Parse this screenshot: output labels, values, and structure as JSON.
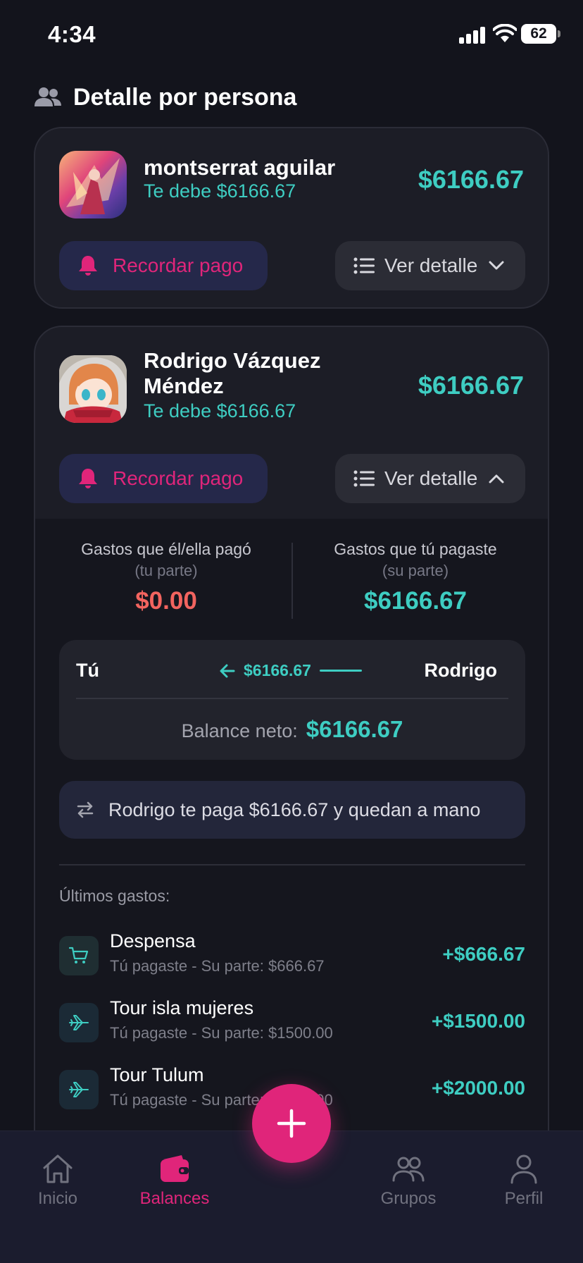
{
  "status_bar": {
    "time": "4:34",
    "battery": "62"
  },
  "section": {
    "title": "Detalle por persona",
    "icon": "people-icon"
  },
  "people": [
    {
      "name": "montserrat aguilar",
      "owes": "Te debe $6166.67",
      "amount": "$6166.67",
      "remind_label": "Recordar pago",
      "detail_label": "Ver detalle"
    },
    {
      "name_line1": "Rodrigo Vázquez",
      "name_line2": "Méndez",
      "owes": "Te debe $6166.67",
      "amount": "$6166.67",
      "remind_label": "Recordar pago",
      "detail_label": "Ver detalle",
      "detail": {
        "paid_by_them_label": "Gastos que él/ella pagó",
        "paid_by_them_sub": "(tu parte)",
        "paid_by_them_value": "$0.00",
        "paid_by_you_label": "Gastos que tú pagaste",
        "paid_by_you_sub": "(su parte)",
        "paid_by_you_value": "$6166.67",
        "flow_you": "Tú",
        "flow_amount": "$6166.67",
        "flow_other": "Rodrigo",
        "balance_label": "Balance neto:",
        "balance_value": "$6166.67",
        "settle_text": "Rodrigo te paga $6166.67 y quedan a mano",
        "last_label": "Últimos gastos:",
        "expenses": [
          {
            "name": "Despensa",
            "sub": "Tú pagaste - Su parte: $666.67",
            "amount": "+$666.67",
            "icon": "cart-icon"
          },
          {
            "name": "Tour isla mujeres",
            "sub": "Tú pagaste - Su parte: $1500.00",
            "amount": "+$1500.00",
            "icon": "plane-icon"
          },
          {
            "name": "Tour Tulum",
            "sub": "Tú pagaste - Su parte: $2000.00",
            "amount": "+$2000.00",
            "icon": "plane-icon"
          }
        ]
      }
    }
  ],
  "nav": {
    "items": [
      {
        "label": "Inicio",
        "icon": "home-icon"
      },
      {
        "label": "Balances",
        "icon": "wallet-icon",
        "active": true
      },
      {
        "label": "Grupos",
        "icon": "group-icon"
      },
      {
        "label": "Perfil",
        "icon": "profile-icon"
      }
    ],
    "fab_icon": "plus-icon"
  },
  "colors": {
    "accent": "#e0257a",
    "positive": "#3ecdc2",
    "negative": "#f2645f",
    "background": "#13141c"
  }
}
